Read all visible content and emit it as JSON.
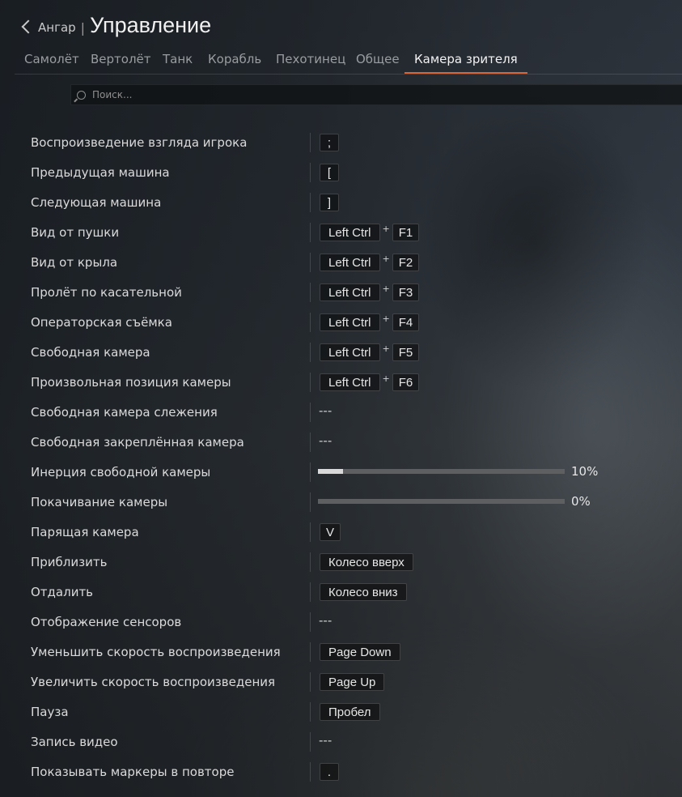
{
  "header": {
    "back_label": "Ангар",
    "separator": "|",
    "title": "Управление"
  },
  "tabs": [
    {
      "label": "Самолёт"
    },
    {
      "label": "Вертолёт"
    },
    {
      "label": "Танк"
    },
    {
      "label": "Корабль"
    },
    {
      "label": "Пехотинец"
    },
    {
      "label": "Общее"
    },
    {
      "label": "Камера зрителя",
      "active": true
    }
  ],
  "search": {
    "placeholder": "Поиск..."
  },
  "accent_color": "#d8643a",
  "rows": [
    {
      "label": "Воспроизведение взгляда игрока",
      "keys": [
        ";"
      ]
    },
    {
      "label": "Предыдущая машина",
      "keys": [
        "["
      ]
    },
    {
      "label": "Следующая машина",
      "keys": [
        "]"
      ]
    },
    {
      "label": "Вид от пушки",
      "keys": [
        "Left Ctrl",
        "F1"
      ]
    },
    {
      "label": "Вид от крыла",
      "keys": [
        "Left Ctrl",
        "F2"
      ]
    },
    {
      "label": "Пролёт по касательной",
      "keys": [
        "Left Ctrl",
        "F3"
      ]
    },
    {
      "label": "Операторская съёмка",
      "keys": [
        "Left Ctrl",
        "F4"
      ]
    },
    {
      "label": "Свободная камера",
      "keys": [
        "Left Ctrl",
        "F5"
      ]
    },
    {
      "label": "Произвольная позиция камеры",
      "keys": [
        "Left Ctrl",
        "F6"
      ]
    },
    {
      "label": "Свободная камера слежения",
      "none": "---"
    },
    {
      "label": "Свободная закреплённая камера",
      "none": "---"
    },
    {
      "label": "Инерция свободной камеры",
      "slider": 10,
      "value_text": "10%"
    },
    {
      "label": "Покачивание камеры",
      "slider": 0,
      "value_text": "0%"
    },
    {
      "label": "Парящая камера",
      "keys": [
        "V"
      ]
    },
    {
      "label": "Приблизить",
      "keys": [
        "Колесо вверх"
      ]
    },
    {
      "label": "Отдалить",
      "keys": [
        "Колесо вниз"
      ]
    },
    {
      "label": "Отображение сенсоров",
      "none": "---"
    },
    {
      "label": "Уменьшить скорость воспроизведения",
      "keys": [
        "Page Down"
      ]
    },
    {
      "label": "Увеличить скорость воспроизведения",
      "keys": [
        "Page Up"
      ]
    },
    {
      "label": "Пауза",
      "keys": [
        "Пробел"
      ]
    },
    {
      "label": "Запись видео",
      "none": "---"
    },
    {
      "label": "Показывать маркеры в повторе",
      "keys": [
        "."
      ]
    }
  ],
  "plus_sign": "+"
}
